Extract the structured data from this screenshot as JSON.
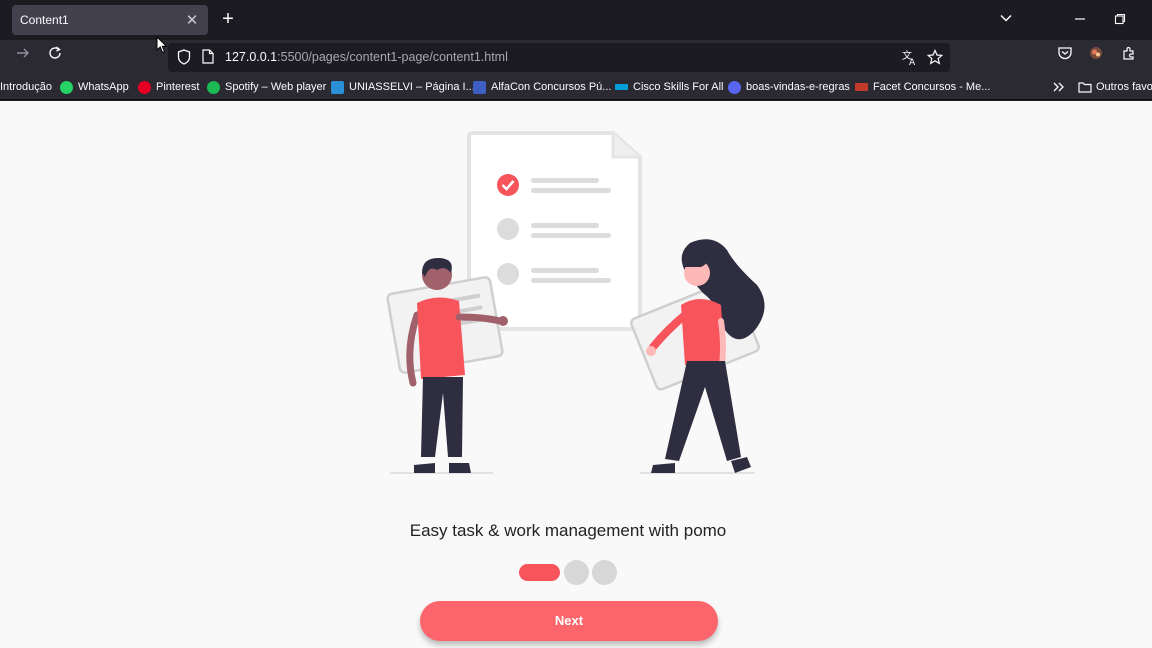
{
  "browser": {
    "tab": {
      "title": "Content1",
      "close": "✕"
    },
    "new_tab": "+",
    "url": {
      "host": "127.0.0.1",
      "rest": ":5500/pages/content1-page/content1.html"
    },
    "bookmarks": [
      {
        "label": "Introdução",
        "icon": "bookmark-icon",
        "color": ""
      },
      {
        "label": "WhatsApp",
        "icon": "whatsapp-icon",
        "color": "#25d366"
      },
      {
        "label": "Pinterest",
        "icon": "pinterest-icon",
        "color": "#e60023"
      },
      {
        "label": "Spotify – Web player",
        "icon": "spotify-icon",
        "color": "#1db954"
      },
      {
        "label": "UNIASSELVI – Página I...",
        "icon": "uniasselvi-icon",
        "color": "#2a8fd6"
      },
      {
        "label": "AlfaCon Concursos Pú...",
        "icon": "alfacon-icon",
        "color": "#3d5fc4"
      },
      {
        "label": "Cisco Skills For All",
        "icon": "cisco-icon",
        "color": "#049fd9"
      },
      {
        "label": "boas-vindas-e-regras",
        "icon": "discord-icon",
        "color": "#5865f2"
      },
      {
        "label": "Facet Concursos - Me...",
        "icon": "facet-icon",
        "color": "#c0392b"
      }
    ],
    "other_bookmarks": "Outros favor"
  },
  "page": {
    "headline": "Easy task & work management with pomo",
    "next_label": "Next",
    "pagination": {
      "current": 1,
      "total": 3
    }
  },
  "colors": {
    "accent": "#fb656b",
    "dot_inactive": "#d7d7d7",
    "page_bg": "#f9f9f9"
  }
}
